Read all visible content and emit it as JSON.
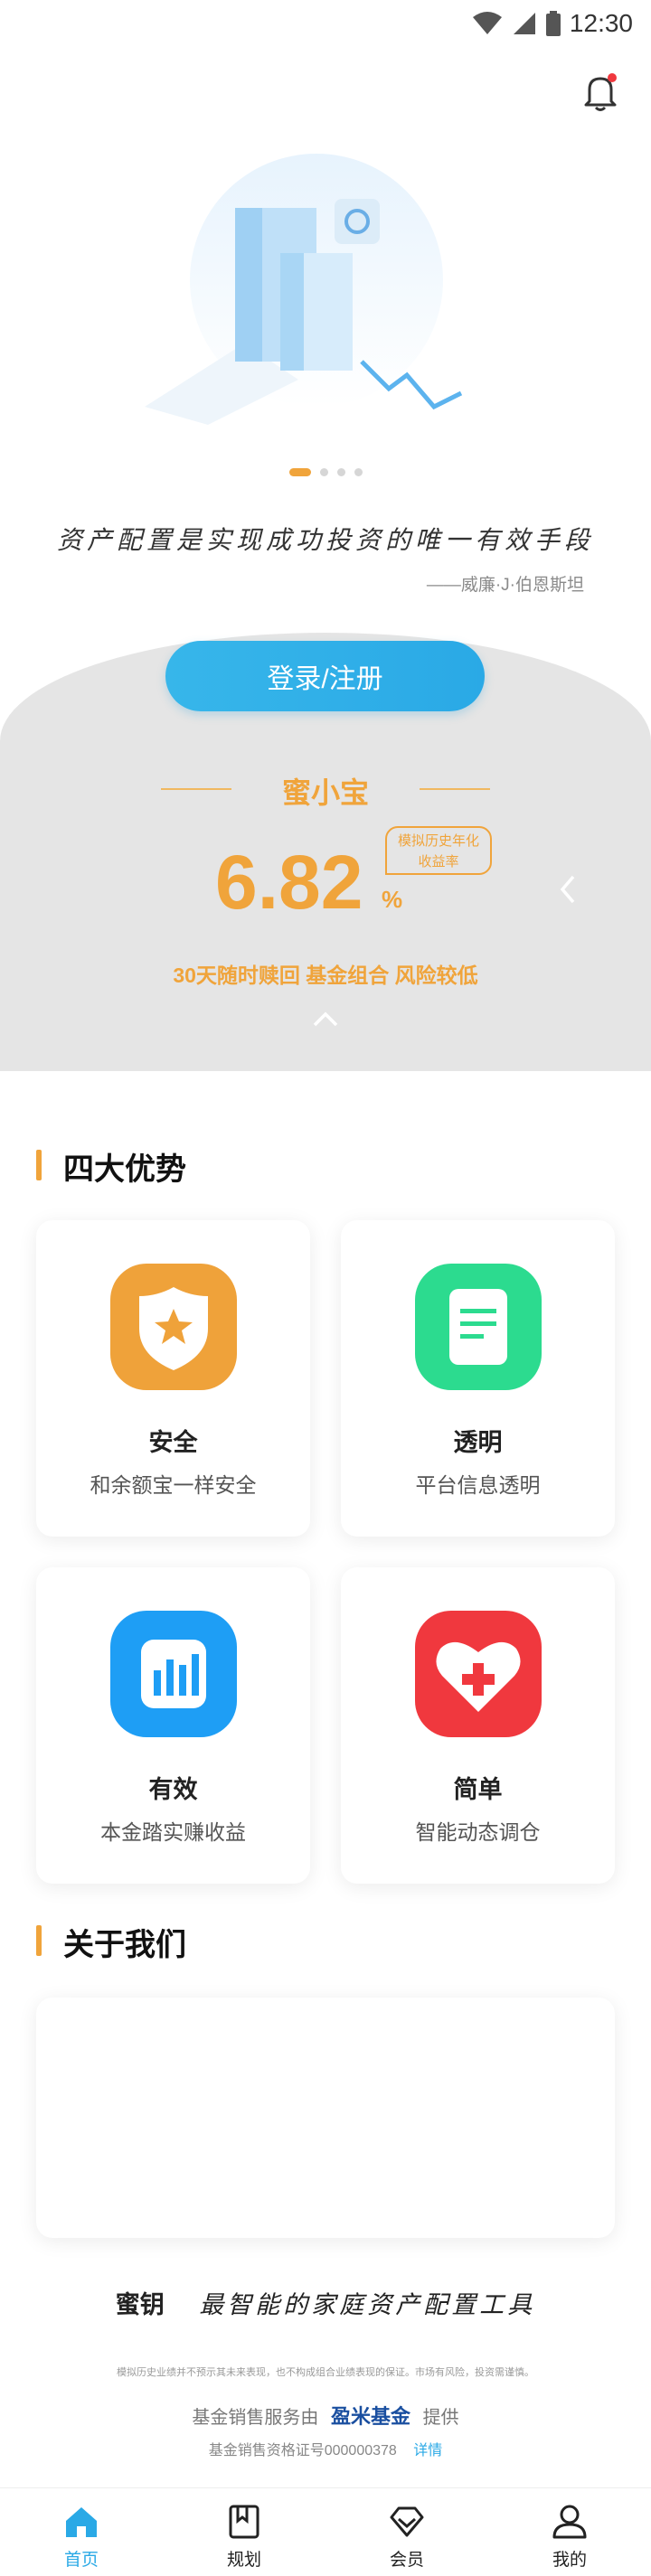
{
  "status_bar": {
    "time": "12:30"
  },
  "carousel": {
    "total": 4,
    "active_index": 0
  },
  "quote": {
    "text": "资产配置是实现成功投资的唯一有效手段",
    "author": "——威廉·J·伯恩斯坦"
  },
  "login_button": "登录/注册",
  "product": {
    "name": "蜜小宝",
    "rate_value": "6.82",
    "rate_unit": "%",
    "rate_badge_line1": "模拟历史年化",
    "rate_badge_line2": "收益率",
    "tags": "30天随时赎回 基金组合 风险较低"
  },
  "advantages": {
    "title": "四大优势",
    "items": [
      {
        "title": "安全",
        "desc": "和余额宝一样安全",
        "icon": "shield-star-icon",
        "color": "#efa23a"
      },
      {
        "title": "透明",
        "desc": "平台信息透明",
        "icon": "document-icon",
        "color": "#2cdb8f"
      },
      {
        "title": "有效",
        "desc": "本金踏实赚收益",
        "icon": "bar-chart-icon",
        "color": "#1e9ef5"
      },
      {
        "title": "简单",
        "desc": "智能动态调仓",
        "icon": "heart-plus-icon",
        "color": "#f0383e"
      }
    ]
  },
  "about": {
    "title": "关于我们"
  },
  "footer": {
    "brand": "蜜钥",
    "tagline": "最智能的家庭资产配置工具",
    "disclaimer": "模拟历史业绩并不预示其未来表现，也不构成组合业绩表现的保证。市场有风险，投资需谨慎。",
    "provider_prefix": "基金销售服务由",
    "provider_logo": "盈米基金",
    "provider_suffix": "提供",
    "license": "基金销售资格证号000000378",
    "license_link": "详情"
  },
  "nav": [
    {
      "label": "首页",
      "icon": "home-icon",
      "active": true
    },
    {
      "label": "规划",
      "icon": "book-icon",
      "active": false
    },
    {
      "label": "会员",
      "icon": "diamond-icon",
      "active": false
    },
    {
      "label": "我的",
      "icon": "user-icon",
      "active": false
    }
  ],
  "colors": {
    "accent": "#f0a43b",
    "primary": "#2aa9e6",
    "panel": "#e5e5e5"
  }
}
